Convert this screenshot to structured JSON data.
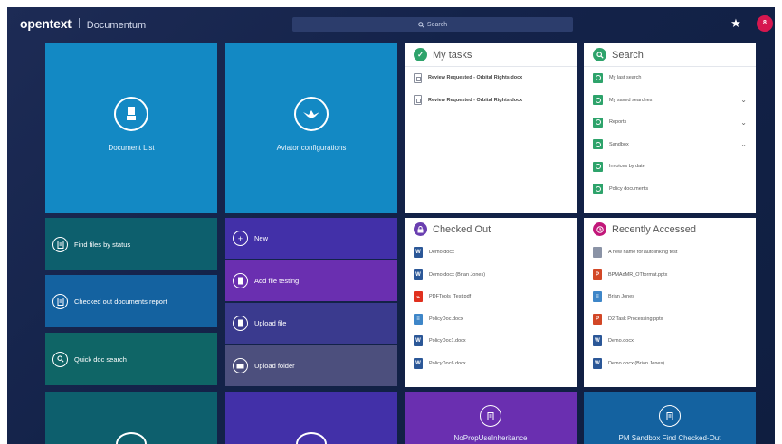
{
  "header": {
    "brand_logo": "opentext",
    "brand_product": "Documentum",
    "search_placeholder": "Search",
    "user_initial": "8"
  },
  "tiles": {
    "document_list": "Document List",
    "aviator_configurations": "Aviator configurations",
    "find_files_by_status": "Find files by status",
    "checked_out_documents_report": "Checked out documents report",
    "quick_doc_search": "Quick doc search",
    "new": "New",
    "add_file_testing": "Add file testing",
    "upload_file": "Upload file",
    "upload_folder": "Upload folder",
    "noprop_tile": "NoPropUseInheritance",
    "pm_sandbox_tile": "PM Sandbox Find Checked-Out"
  },
  "my_tasks": {
    "title": "My tasks",
    "items": [
      "Review Requested - Orbital Rights.docx",
      "Review Requested - Orbital Rights.docx"
    ]
  },
  "search_panel": {
    "title": "Search",
    "items": [
      {
        "label": "My last search",
        "expandable": false
      },
      {
        "label": "My saved searches",
        "expandable": true
      },
      {
        "label": "Reports",
        "expandable": true
      },
      {
        "label": "Sandbox",
        "expandable": true
      },
      {
        "label": "Invoices by date",
        "expandable": false
      },
      {
        "label": "Policy documents",
        "expandable": false
      }
    ]
  },
  "checked_out": {
    "title": "Checked Out",
    "items": [
      {
        "label": "Demo.docx",
        "type": "word"
      },
      {
        "label": "Demo.docx (Brian Jones)",
        "type": "word"
      },
      {
        "label": "PDFTools_Test.pdf",
        "type": "pdf"
      },
      {
        "label": "PolicyDoc.docx",
        "type": "list"
      },
      {
        "label": "PolicyDoc1.docx",
        "type": "word"
      },
      {
        "label": "PolicyDoc6.docx",
        "type": "word"
      }
    ]
  },
  "recently_accessed": {
    "title": "Recently Accessed",
    "items": [
      {
        "label": "A new name for autolinking test",
        "type": "generic"
      },
      {
        "label": "BPMAdMR_OTformat.pptx",
        "type": "ppt"
      },
      {
        "label": "Brian Jones",
        "type": "list"
      },
      {
        "label": "D2 Task Processing.pptx",
        "type": "ppt"
      },
      {
        "label": "Demo.docx",
        "type": "word"
      },
      {
        "label": "Demo.docx (Brian Jones)",
        "type": "word"
      }
    ]
  },
  "colors": {
    "tile_blue": "#1389c4",
    "tile_teal": "#0d5f6d",
    "tile_mid_blue": "#1462a0",
    "tile_green_teal": "#0f6566",
    "tile_indigo": "#4230a8",
    "tile_purple": "#6a2fb0",
    "tile_navy": "#3a3a8e",
    "tile_slate": "#4c4f7d",
    "accent_green": "#2ea36b",
    "accent_purple": "#6a3fb0",
    "accent_pink": "#c2187a"
  }
}
